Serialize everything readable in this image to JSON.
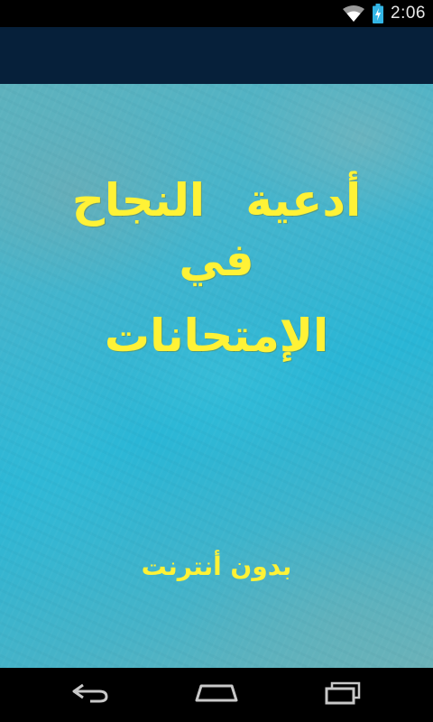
{
  "status_bar": {
    "time": "2:06",
    "icons": [
      "wifi-icon",
      "battery-charging-icon"
    ]
  },
  "splash": {
    "title_line_1": "أدعية النجاح",
    "title_line_2": "في",
    "title_line_3": "الإمتحانات",
    "subtitle": "بدون أنترنت"
  },
  "nav_bar": {
    "icons": [
      "back-icon",
      "home-icon",
      "recent-apps-icon"
    ]
  },
  "colors": {
    "title_yellow": "#fff236",
    "action_bar": "#06203a",
    "background_teal": "#3fb5cf"
  }
}
